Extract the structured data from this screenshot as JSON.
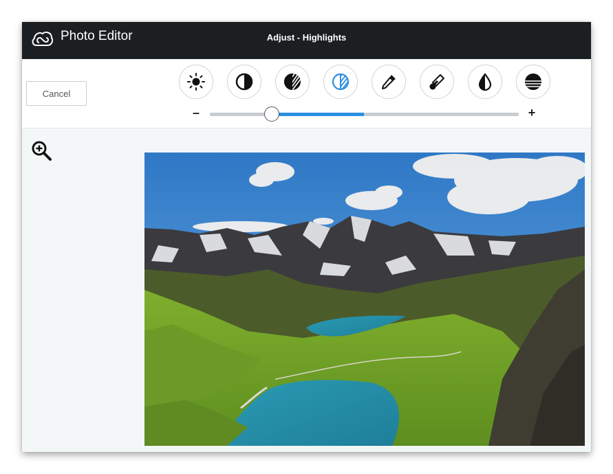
{
  "header": {
    "app_title": "Photo Editor",
    "mode_title": "Adjust - Highlights"
  },
  "toolbar": {
    "cancel_label": "Cancel",
    "tools": [
      {
        "name": "brightness-icon",
        "active": false
      },
      {
        "name": "contrast-icon",
        "active": false
      },
      {
        "name": "shadows-icon",
        "active": false
      },
      {
        "name": "highlights-icon",
        "active": true
      },
      {
        "name": "eyedropper-icon",
        "active": false
      },
      {
        "name": "temperature-icon",
        "active": false
      },
      {
        "name": "saturation-icon",
        "active": false
      },
      {
        "name": "fade-icon",
        "active": false
      }
    ],
    "slider": {
      "minus_label": "–",
      "plus_label": "+",
      "min": -100,
      "max": 100,
      "value": -60
    }
  },
  "colors": {
    "accent": "#2b8fe0",
    "titlebar": "#1b1f22",
    "canvas_bg": "#f4f7f8"
  },
  "canvas": {
    "zoom_icon": "zoom-in-icon",
    "photo_description_icon": "landscape-photo"
  }
}
